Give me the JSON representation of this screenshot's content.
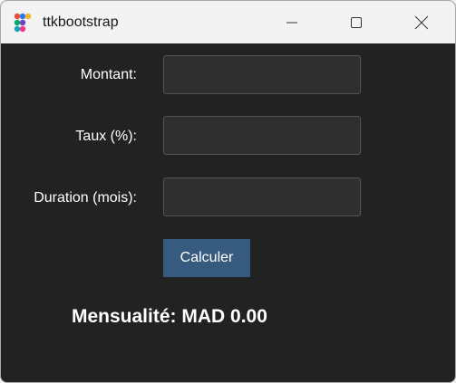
{
  "window": {
    "title": "ttkbootstrap",
    "icon": "ttkbootstrap-logo-icon",
    "controls": [
      "minimize-icon",
      "maximize-icon",
      "close-icon"
    ]
  },
  "form": {
    "amount_label": "Montant:",
    "amount_value": "",
    "rate_label": "Taux (%):",
    "rate_value": "",
    "duration_label": "Duration (mois):",
    "duration_value": "",
    "calculate_label": "Calculer"
  },
  "result": {
    "text": "Mensualité: MAD 0.00"
  },
  "colors": {
    "background": "#222222",
    "entry_background": "#2f2f2f",
    "entry_border": "#555555",
    "button_primary": "#375a7f",
    "text": "#ffffff"
  }
}
